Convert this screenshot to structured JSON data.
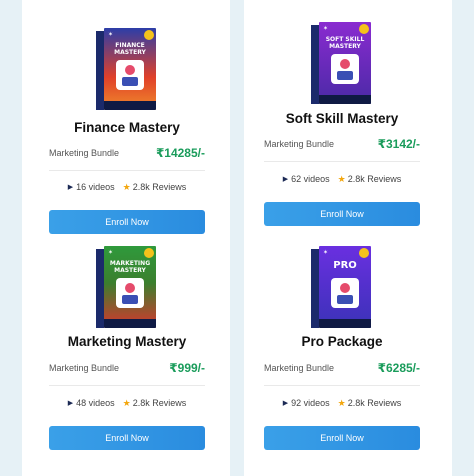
{
  "products": [
    {
      "box_title": "FINANCE MASTERY",
      "box_side": "FINANCE MASTERY",
      "title": "Finance Mastery",
      "bundle": "Marketing Bundle",
      "price": "₹14285/-",
      "videos": "16 videos",
      "reviews": "2.8k Reviews",
      "button": "Enroll Now",
      "box_color": "#e0402a",
      "box_color2": "#233a9a"
    },
    {
      "box_title": "SOFT SKILL MASTERY",
      "box_side": "SOFT SKILL MASTERY",
      "title": "Soft Skill Mastery",
      "bundle": "Marketing Bundle",
      "price": "₹3142/-",
      "videos": "62 videos",
      "reviews": "2.8k Reviews",
      "button": "Enroll Now",
      "box_color": "#7b2bc4",
      "box_color2": "#2a1f8a"
    },
    {
      "box_title": "MARKETING MASTERY",
      "box_side": "MARKETING MASTERY",
      "title": "Marketing Mastery",
      "bundle": "Marketing Bundle",
      "price": "₹999/-",
      "videos": "48 videos",
      "reviews": "2.8k Reviews",
      "button": "Enroll Now",
      "box_color": "#2f9a3c",
      "box_color2": "#d8362e"
    },
    {
      "box_title": "PRO",
      "box_side": "PRO PACKAGE",
      "title": "Pro Package",
      "bundle": "Marketing Bundle",
      "price": "₹6285/-",
      "videos": "92 videos",
      "reviews": "2.8k Reviews",
      "button": "Enroll Now",
      "box_color": "#5b2fd6",
      "box_color2": "#1f3a9a"
    }
  ],
  "colors": {
    "price": "#1a9c5b",
    "button_start": "#3aa0e8",
    "button_end": "#2a8cdf",
    "star": "#f3a70e"
  }
}
